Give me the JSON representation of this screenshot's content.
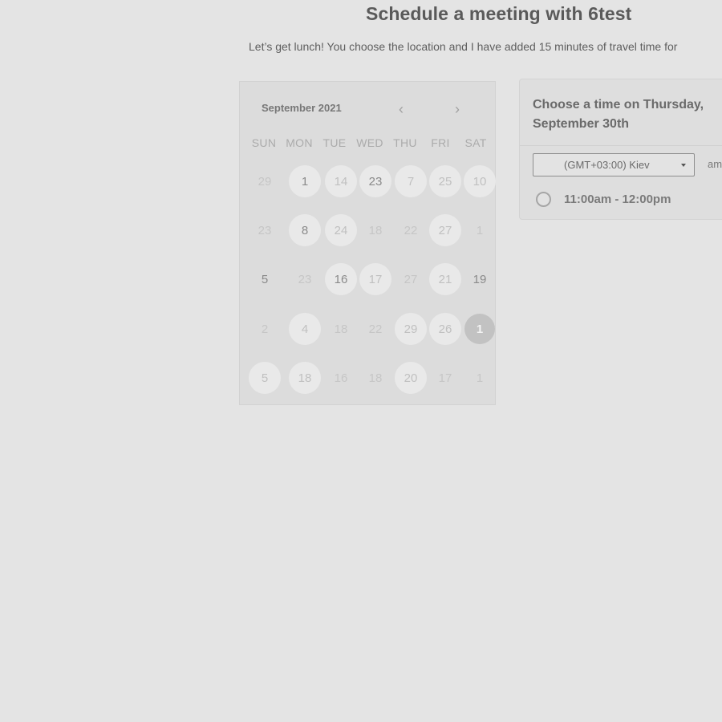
{
  "header": {
    "title": "Schedule a meeting with 6test",
    "subtitle": "Let’s get lunch! You choose the location and I have added 15 minutes of travel time for"
  },
  "calendar": {
    "month_label": "September 2021",
    "prev_icon": "chevron-left-icon",
    "next_icon": "chevron-right-icon",
    "prev_symbol": "‹",
    "next_symbol": "›",
    "weekdays": [
      "SUN",
      "MON",
      "TUE",
      "WED",
      "THU",
      "FRI",
      "SAT"
    ],
    "weeks": [
      [
        {
          "d": "29",
          "state": "plain"
        },
        {
          "d": "1",
          "state": "avail-dark"
        },
        {
          "d": "14",
          "state": "avail"
        },
        {
          "d": "23",
          "state": "avail-dark"
        },
        {
          "d": "7",
          "state": "avail"
        },
        {
          "d": "25",
          "state": "avail"
        },
        {
          "d": "10",
          "state": "avail"
        }
      ],
      [
        {
          "d": "23",
          "state": "plain"
        },
        {
          "d": "8",
          "state": "avail-dark"
        },
        {
          "d": "24",
          "state": "avail"
        },
        {
          "d": "18",
          "state": "plain"
        },
        {
          "d": "22",
          "state": "plain"
        },
        {
          "d": "27",
          "state": "avail"
        },
        {
          "d": "1",
          "state": "plain"
        }
      ],
      [
        {
          "d": "5",
          "state": "dark"
        },
        {
          "d": "23",
          "state": "plain"
        },
        {
          "d": "16",
          "state": "avail-dark"
        },
        {
          "d": "17",
          "state": "avail"
        },
        {
          "d": "27",
          "state": "plain"
        },
        {
          "d": "21",
          "state": "avail"
        },
        {
          "d": "19",
          "state": "dark"
        }
      ],
      [
        {
          "d": "2",
          "state": "plain"
        },
        {
          "d": "4",
          "state": "avail"
        },
        {
          "d": "18",
          "state": "plain"
        },
        {
          "d": "22",
          "state": "plain"
        },
        {
          "d": "29",
          "state": "avail"
        },
        {
          "d": "26",
          "state": "avail"
        },
        {
          "d": "1",
          "state": "selected"
        }
      ],
      [
        {
          "d": "5",
          "state": "avail"
        },
        {
          "d": "18",
          "state": "avail"
        },
        {
          "d": "16",
          "state": "plain"
        },
        {
          "d": "18",
          "state": "plain"
        },
        {
          "d": "20",
          "state": "avail"
        },
        {
          "d": "17",
          "state": "plain"
        },
        {
          "d": "1",
          "state": "plain"
        }
      ]
    ]
  },
  "time_panel": {
    "heading": "Choose a time on Thursday, September 30th",
    "timezone_value": "(GMT+03:00) Kiev",
    "timezone_icon": "caret-down-icon",
    "format_label": "am",
    "slots": [
      {
        "label": "11:00am - 12:00pm",
        "selected": false
      }
    ]
  },
  "colors": {
    "background": "#e4e4e4",
    "calendar_bg": "#dcdcdc",
    "selected_day": "#c2c2c2"
  }
}
